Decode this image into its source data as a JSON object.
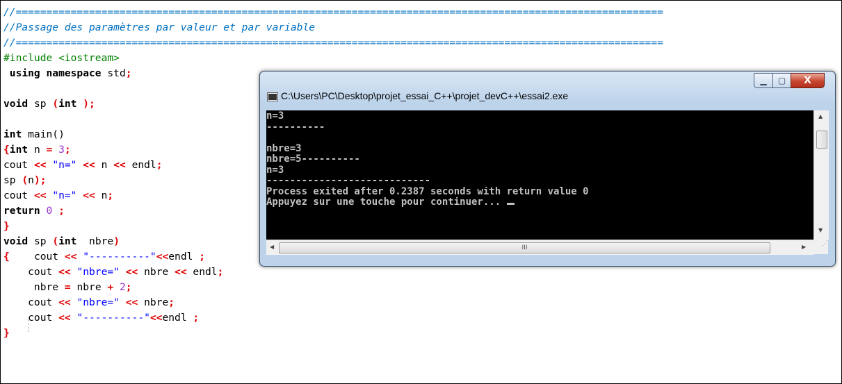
{
  "editor": {
    "lines": [
      [
        {
          "t": "//==========================================================================================================",
          "c": "cm"
        }
      ],
      [
        {
          "t": "//Passage des paramètres par valeur et par variable",
          "c": "cm"
        }
      ],
      [
        {
          "t": "//==========================================================================================================",
          "c": "cm"
        }
      ],
      [
        {
          "t": "#include <iostream>",
          "c": "dir"
        }
      ],
      [
        {
          "t": " using namespace",
          "c": "kw"
        },
        {
          "t": " std",
          "c": "pl"
        },
        {
          "t": ";",
          "c": "sy"
        }
      ],
      [],
      [
        {
          "t": "void",
          "c": "kw"
        },
        {
          "t": " sp ",
          "c": "pl"
        },
        {
          "t": "(",
          "c": "sy"
        },
        {
          "t": "int",
          "c": "kw"
        },
        {
          "t": " );",
          "c": "sy"
        }
      ],
      [],
      [
        {
          "t": "int",
          "c": "kw"
        },
        {
          "t": " main()",
          "c": "pl"
        }
      ],
      [
        {
          "t": "{",
          "c": "sy"
        },
        {
          "t": "int",
          "c": "kw"
        },
        {
          "t": " n ",
          "c": "pl"
        },
        {
          "t": "=",
          "c": "op"
        },
        {
          "t": " ",
          "c": "pl"
        },
        {
          "t": "3",
          "c": "nu"
        },
        {
          "t": ";",
          "c": "sy"
        }
      ],
      [
        {
          "t": "cout ",
          "c": "pl"
        },
        {
          "t": "<<",
          "c": "op"
        },
        {
          "t": " ",
          "c": "pl"
        },
        {
          "t": "\"n=\"",
          "c": "st"
        },
        {
          "t": " ",
          "c": "pl"
        },
        {
          "t": "<<",
          "c": "op"
        },
        {
          "t": " n ",
          "c": "pl"
        },
        {
          "t": "<<",
          "c": "op"
        },
        {
          "t": " endl",
          "c": "pl"
        },
        {
          "t": ";",
          "c": "sy"
        }
      ],
      [
        {
          "t": "sp ",
          "c": "pl"
        },
        {
          "t": "(",
          "c": "sy"
        },
        {
          "t": "n",
          "c": "pl"
        },
        {
          "t": ");",
          "c": "sy"
        }
      ],
      [
        {
          "t": "cout ",
          "c": "pl"
        },
        {
          "t": "<<",
          "c": "op"
        },
        {
          "t": " ",
          "c": "pl"
        },
        {
          "t": "\"n=\"",
          "c": "st"
        },
        {
          "t": " ",
          "c": "pl"
        },
        {
          "t": "<<",
          "c": "op"
        },
        {
          "t": " n",
          "c": "pl"
        },
        {
          "t": ";",
          "c": "sy"
        }
      ],
      [
        {
          "t": "return",
          "c": "kw"
        },
        {
          "t": " ",
          "c": "pl"
        },
        {
          "t": "0",
          "c": "nu"
        },
        {
          "t": " ;",
          "c": "sy"
        }
      ],
      [
        {
          "t": "}",
          "c": "sy"
        }
      ],
      [
        {
          "t": "void",
          "c": "kw"
        },
        {
          "t": " sp ",
          "c": "pl"
        },
        {
          "t": "(",
          "c": "sy"
        },
        {
          "t": "int",
          "c": "kw"
        },
        {
          "t": "  nbre",
          "c": "pl"
        },
        {
          "t": ")",
          "c": "sy"
        }
      ],
      [
        {
          "t": "{",
          "c": "sy"
        },
        {
          "t": "    cout ",
          "c": "pl"
        },
        {
          "t": "<<",
          "c": "op"
        },
        {
          "t": " ",
          "c": "pl"
        },
        {
          "t": "\"----------\"",
          "c": "st"
        },
        {
          "t": "<<",
          "c": "op"
        },
        {
          "t": "endl ",
          "c": "pl"
        },
        {
          "t": ";",
          "c": "sy"
        }
      ],
      [
        {
          "t": "    cout ",
          "c": "pl"
        },
        {
          "t": "<<",
          "c": "op"
        },
        {
          "t": " ",
          "c": "pl"
        },
        {
          "t": "\"nbre=\"",
          "c": "st"
        },
        {
          "t": " ",
          "c": "pl"
        },
        {
          "t": "<<",
          "c": "op"
        },
        {
          "t": " nbre ",
          "c": "pl"
        },
        {
          "t": "<<",
          "c": "op"
        },
        {
          "t": " endl",
          "c": "pl"
        },
        {
          "t": ";",
          "c": "sy"
        }
      ],
      [
        {
          "t": "     nbre ",
          "c": "pl"
        },
        {
          "t": "=",
          "c": "op"
        },
        {
          "t": " nbre ",
          "c": "pl"
        },
        {
          "t": "+",
          "c": "op"
        },
        {
          "t": " ",
          "c": "pl"
        },
        {
          "t": "2",
          "c": "nu"
        },
        {
          "t": ";",
          "c": "sy"
        }
      ],
      [
        {
          "t": "    cout ",
          "c": "pl"
        },
        {
          "t": "<<",
          "c": "op"
        },
        {
          "t": " ",
          "c": "pl"
        },
        {
          "t": "\"nbre=\"",
          "c": "st"
        },
        {
          "t": " ",
          "c": "pl"
        },
        {
          "t": "<<",
          "c": "op"
        },
        {
          "t": " nbre",
          "c": "pl"
        },
        {
          "t": ";",
          "c": "sy"
        }
      ],
      [
        {
          "t": "    cout ",
          "c": "pl"
        },
        {
          "t": "<<",
          "c": "op"
        },
        {
          "t": " ",
          "c": "pl"
        },
        {
          "t": "\"----------\"",
          "c": "st"
        },
        {
          "t": "<<",
          "c": "op"
        },
        {
          "t": "endl ",
          "c": "pl"
        },
        {
          "t": ";",
          "c": "sy"
        }
      ],
      [
        {
          "t": "}",
          "c": "sy"
        }
      ]
    ]
  },
  "console_window": {
    "title": "C:\\Users\\PC\\Desktop\\projet_essai_C++\\projet_devC++\\essai2.exe",
    "minimize_glyph": "▁",
    "maximize_glyph": "▢",
    "close_glyph": "X",
    "output_lines": [
      "n=3",
      "----------",
      "",
      "nbre=3",
      "nbre=5----------",
      "n=3",
      "----------------------------",
      "Process exited after 0.2387 seconds with return value 0",
      "Appuyez sur une touche pour continuer... "
    ],
    "scroll_up": "▲",
    "scroll_down": "▼",
    "scroll_left": "◀",
    "scroll_right": "▶",
    "hthumb_grip": "III",
    "resize_grip": "⋰"
  }
}
